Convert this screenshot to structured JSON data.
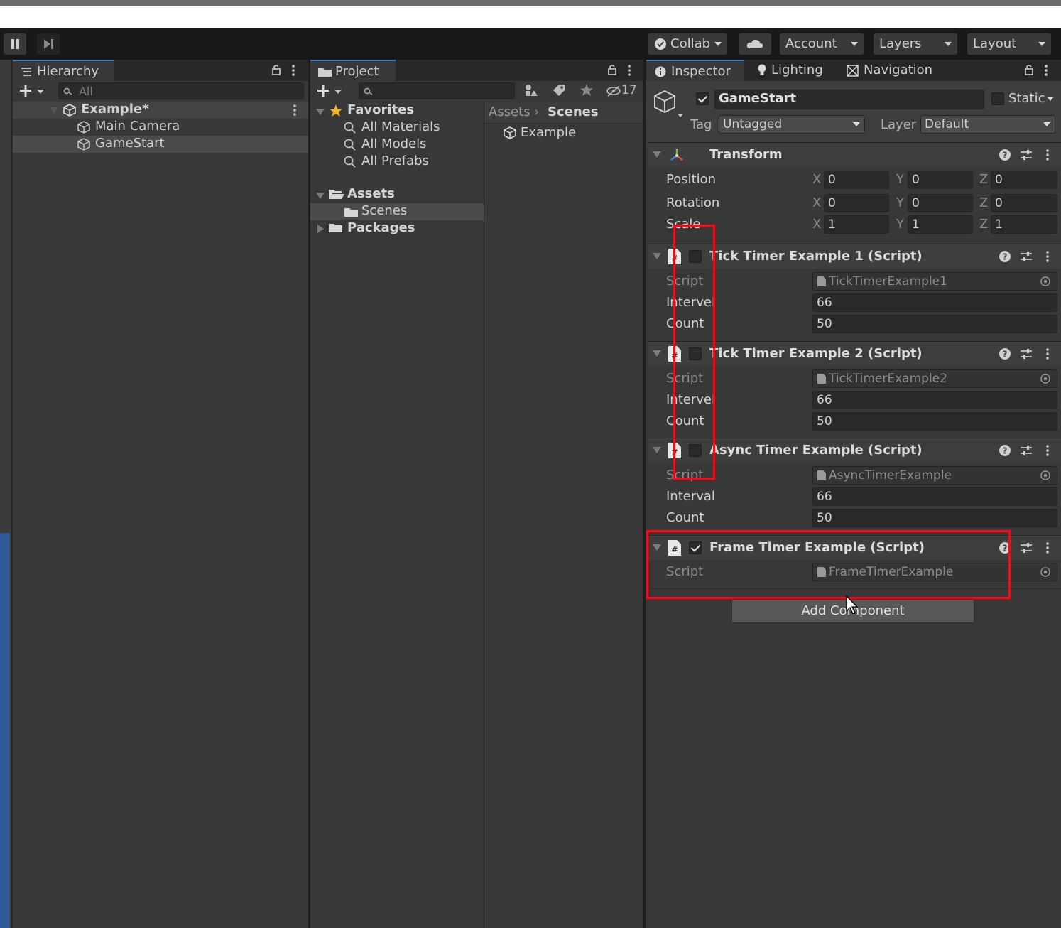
{
  "toolbar": {
    "collab": "Collab",
    "account": "Account",
    "layers": "Layers",
    "layout": "Layout"
  },
  "hierarchy": {
    "tab": "Hierarchy",
    "search_placeholder": "All",
    "scene": "Example*",
    "items": [
      "Main Camera",
      "GameStart"
    ]
  },
  "project": {
    "tab": "Project",
    "hidden_count": "17",
    "favorites_label": "Favorites",
    "favorites": [
      "All Materials",
      "All Models",
      "All Prefabs"
    ],
    "assets_label": "Assets",
    "assets_children": [
      "Scenes"
    ],
    "packages_label": "Packages",
    "breadcrumb": [
      "Assets",
      "Scenes"
    ],
    "files": [
      "Example"
    ]
  },
  "inspector": {
    "tabs": [
      "Inspector",
      "Lighting",
      "Navigation"
    ],
    "object_name": "GameStart",
    "static_label": "Static",
    "tag_label": "Tag",
    "tag_value": "Untagged",
    "layer_label": "Layer",
    "layer_value": "Default",
    "transform": {
      "title": "Transform",
      "rows": [
        {
          "label": "Position",
          "x": "0",
          "y": "0",
          "z": "0"
        },
        {
          "label": "Rotation",
          "x": "0",
          "y": "0",
          "z": "0"
        },
        {
          "label": "Scale",
          "x": "1",
          "y": "1",
          "z": "1"
        }
      ]
    },
    "components": [
      {
        "title": "Tick Timer Example 1 (Script)",
        "enabled": false,
        "script": "TickTimerExample1",
        "interval_label": "Intervel",
        "interval": "66",
        "count_label": "Count",
        "count": "50"
      },
      {
        "title": "Tick Timer Example 2 (Script)",
        "enabled": false,
        "script": "TickTimerExample2",
        "interval_label": "Intervel",
        "interval": "66",
        "count_label": "Count",
        "count": "50"
      },
      {
        "title": "Async Timer Example (Script)",
        "enabled": false,
        "script": "AsyncTimerExample",
        "interval_label": "Interval",
        "interval": "66",
        "count_label": "Count",
        "count": "50"
      },
      {
        "title": "Frame Timer Example (Script)",
        "enabled": true,
        "script": "FrameTimerExample"
      }
    ],
    "script_label": "Script",
    "add_component": "Add Component"
  },
  "colors": {
    "highlight_box": "#e0141e",
    "active_tab_accent": "#3a79bb"
  }
}
